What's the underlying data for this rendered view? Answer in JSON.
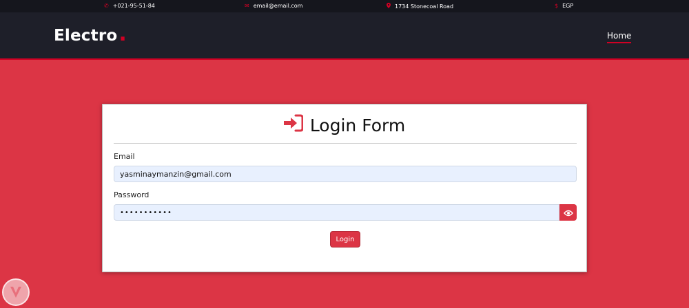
{
  "topbar": {
    "phone": "+021-95-51-84",
    "email": "email@email.com",
    "address": "1734 Stonecoal Road",
    "currency": "EGP",
    "icons": [
      "phone-icon",
      "envelope-icon",
      "map-marker-icon",
      "dollar-icon"
    ]
  },
  "header": {
    "logo": "Electro",
    "logo_dot": ".",
    "nav": {
      "home": "Home"
    }
  },
  "form": {
    "title": "Login Form",
    "email_label": "Email",
    "email_value": "yasminaymanzin@gmail.com",
    "password_label": "Password",
    "password_value": "•••••••••••",
    "login_label": "Login"
  },
  "colors": {
    "accent": "#dc3545",
    "brand_red": "#d10024",
    "dark": "#1e1f29",
    "topbar": "#15161d",
    "input_bg": "#e8f0fe"
  }
}
